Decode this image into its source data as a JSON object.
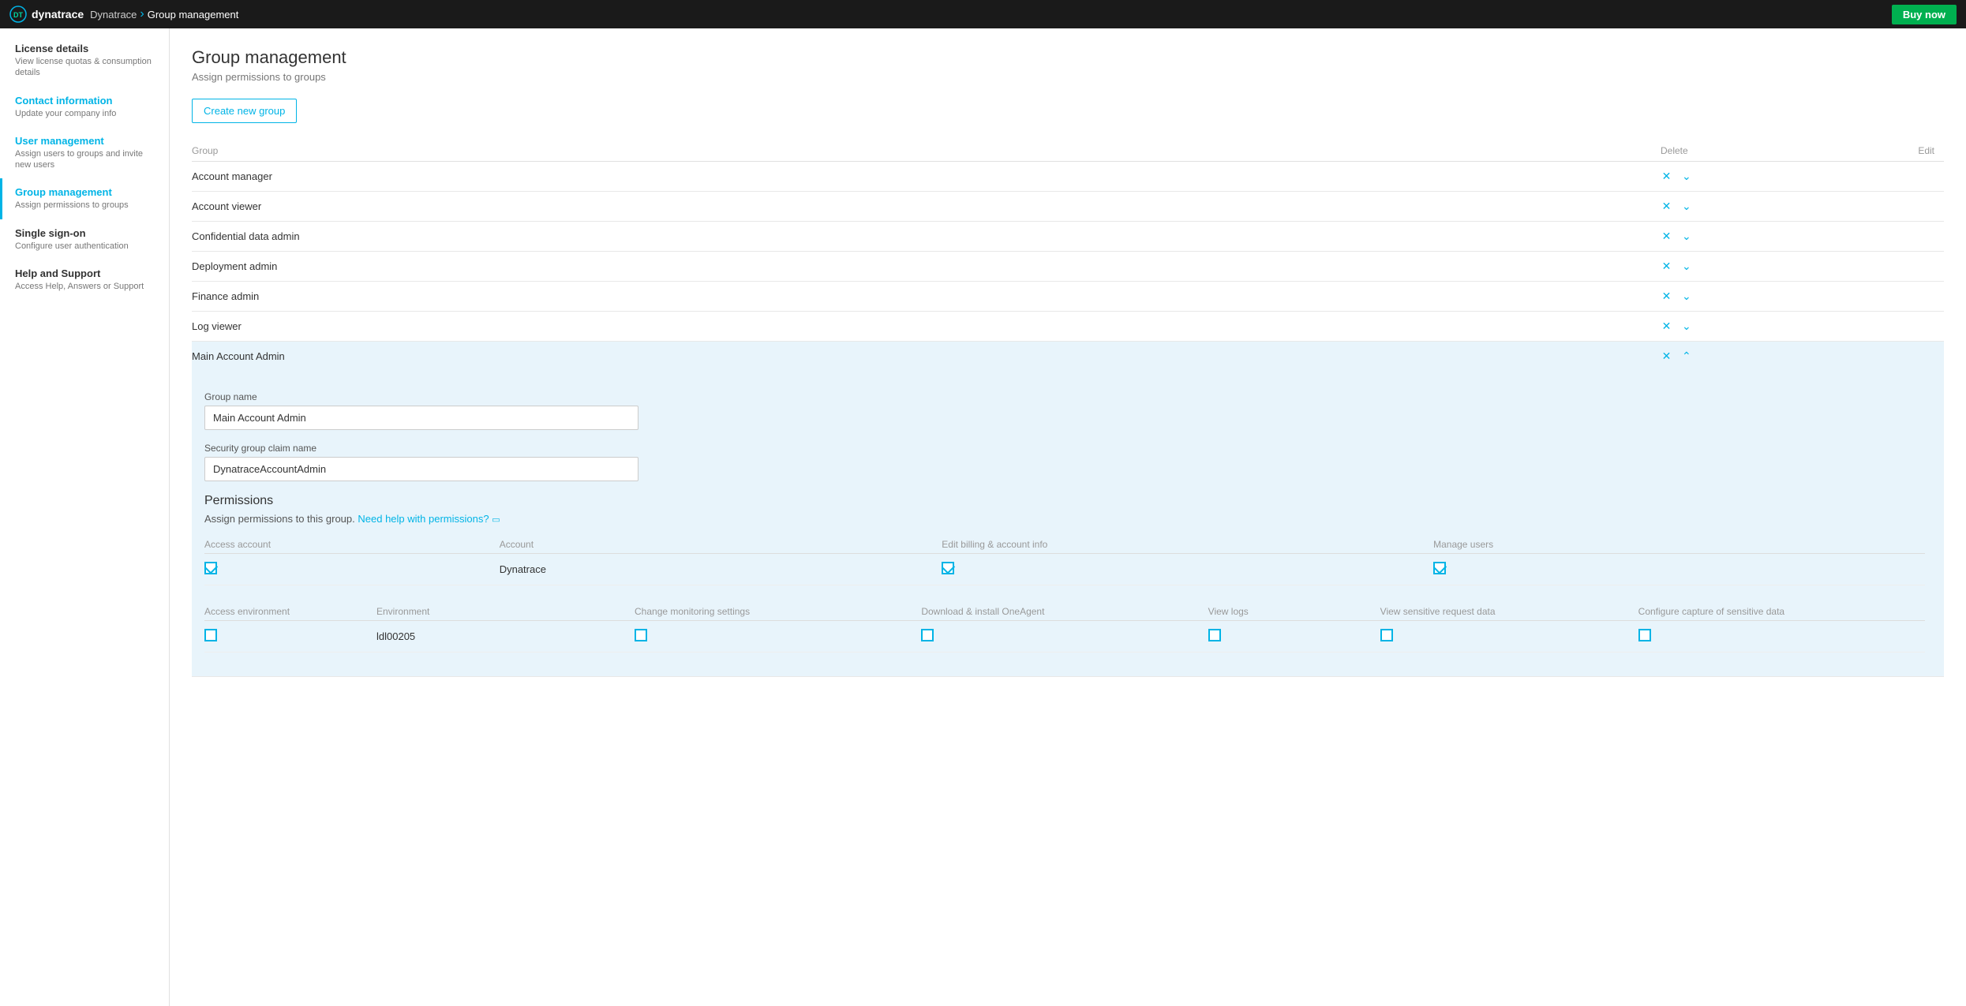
{
  "topnav": {
    "logo_text": "dynatrace",
    "breadcrumb_parent": "Dynatrace",
    "breadcrumb_current": "Group management",
    "buy_now_label": "Buy now"
  },
  "sidebar": {
    "items": [
      {
        "id": "license-details",
        "title": "License details",
        "desc": "View license quotas & consumption details",
        "active": false
      },
      {
        "id": "contact-information",
        "title": "Contact information",
        "desc": "Update your company info",
        "active": false
      },
      {
        "id": "user-management",
        "title": "User management",
        "desc": "Assign users to groups and invite new users",
        "active": false
      },
      {
        "id": "group-management",
        "title": "Group management",
        "desc": "Assign permissions to groups",
        "active": true
      },
      {
        "id": "single-sign-on",
        "title": "Single sign-on",
        "desc": "Configure user authentication",
        "active": false
      },
      {
        "id": "help-and-support",
        "title": "Help and Support",
        "desc": "Access Help, Answers or Support",
        "active": false
      }
    ]
  },
  "main": {
    "page_title": "Group management",
    "page_subtitle": "Assign permissions to groups",
    "create_button_label": "Create new group",
    "table": {
      "col_group": "Group",
      "col_delete": "Delete",
      "col_edit": "Edit",
      "rows": [
        {
          "name": "Account manager",
          "expanded": false
        },
        {
          "name": "Account viewer",
          "expanded": false
        },
        {
          "name": "Confidential data admin",
          "expanded": false
        },
        {
          "name": "Deployment admin",
          "expanded": false
        },
        {
          "name": "Finance admin",
          "expanded": false
        },
        {
          "name": "Log viewer",
          "expanded": false
        },
        {
          "name": "Main Account Admin",
          "expanded": true
        }
      ]
    },
    "expanded_row": {
      "group_name_label": "Group name",
      "group_name_value": "Main Account Admin",
      "security_claim_label": "Security group claim name",
      "security_claim_value": "DynatraceAccountAdmin",
      "permissions_title": "Permissions",
      "permissions_desc": "Assign permissions to this group.",
      "need_help_text": "Need help with permissions?",
      "account_table": {
        "col_access_account": "Access account",
        "col_account": "Account",
        "col_edit_billing": "Edit billing & account info",
        "col_manage_users": "Manage users",
        "rows": [
          {
            "access_account": true,
            "account": "Dynatrace",
            "edit_billing": true,
            "manage_users": true
          }
        ]
      },
      "env_table": {
        "col_access_environment": "Access environment",
        "col_environment": "Environment",
        "col_change_monitoring": "Change monitoring settings",
        "col_download_install": "Download & install OneAgent",
        "col_view_logs": "View logs",
        "col_view_sensitive": "View sensitive request data",
        "col_configure_capture": "Configure capture of sensitive data",
        "rows": [
          {
            "access_environment": false,
            "environment": "ldl00205",
            "change_monitoring": false,
            "download_install": false,
            "view_logs": false,
            "view_sensitive": false,
            "configure_capture": false
          }
        ]
      }
    }
  }
}
